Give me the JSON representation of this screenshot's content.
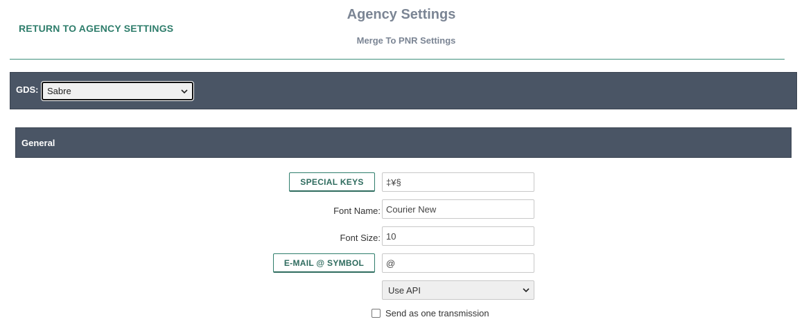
{
  "header": {
    "return_link": "RETURN TO AGENCY SETTINGS",
    "title": "Agency Settings",
    "subtitle": "Merge To PNR Settings"
  },
  "gds": {
    "label": "GDS:",
    "selected": "Sabre"
  },
  "section": {
    "title": "General"
  },
  "form": {
    "special_keys_button": "SPECIAL KEYS",
    "special_keys_value": "‡¥§",
    "font_name_label": "Font Name:",
    "font_name_value": "Courier New",
    "font_size_label": "Font Size:",
    "font_size_value": "10",
    "email_symbol_button": "E-MAIL @ SYMBOL",
    "email_symbol_value": "@",
    "transmission_method": "Use API",
    "send_one_label": "Send as one transmission",
    "send_one_checked": false
  },
  "colors": {
    "accent_green": "#2e7d6b",
    "bar_slate": "#4a5565",
    "title_gray": "#7b8594"
  }
}
